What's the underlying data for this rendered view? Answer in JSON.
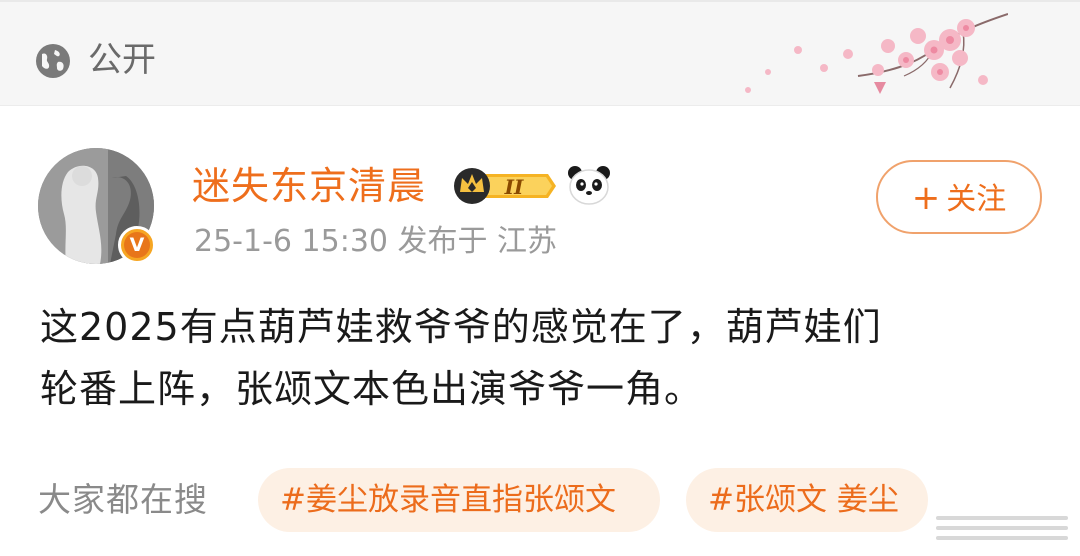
{
  "visibility": {
    "icon": "globe-icon",
    "label": "公开"
  },
  "post": {
    "author": {
      "name": "迷失东京清晨",
      "verified_mark": "V",
      "vip_level": "II",
      "emoji": "panda-icon"
    },
    "meta": "25-1-6 15:30  发布于 江苏",
    "follow_button": {
      "plus": "+",
      "label": "关注"
    },
    "content": [
      "这2025有点葫芦娃救爷爷的感觉在了，葫芦娃们",
      "轮番上阵，张颂文本色出演爷爷一角。"
    ]
  },
  "trending": {
    "label": "大家都在搜",
    "topics": [
      "#姜尘放录音直指张颂文",
      "#张颂文 姜尘"
    ]
  },
  "colors": {
    "accent": "#ee6e1c",
    "chip_bg": "#fdf0e4",
    "meta": "#9a9a9a",
    "topbar_bg": "#f6f6f6"
  }
}
